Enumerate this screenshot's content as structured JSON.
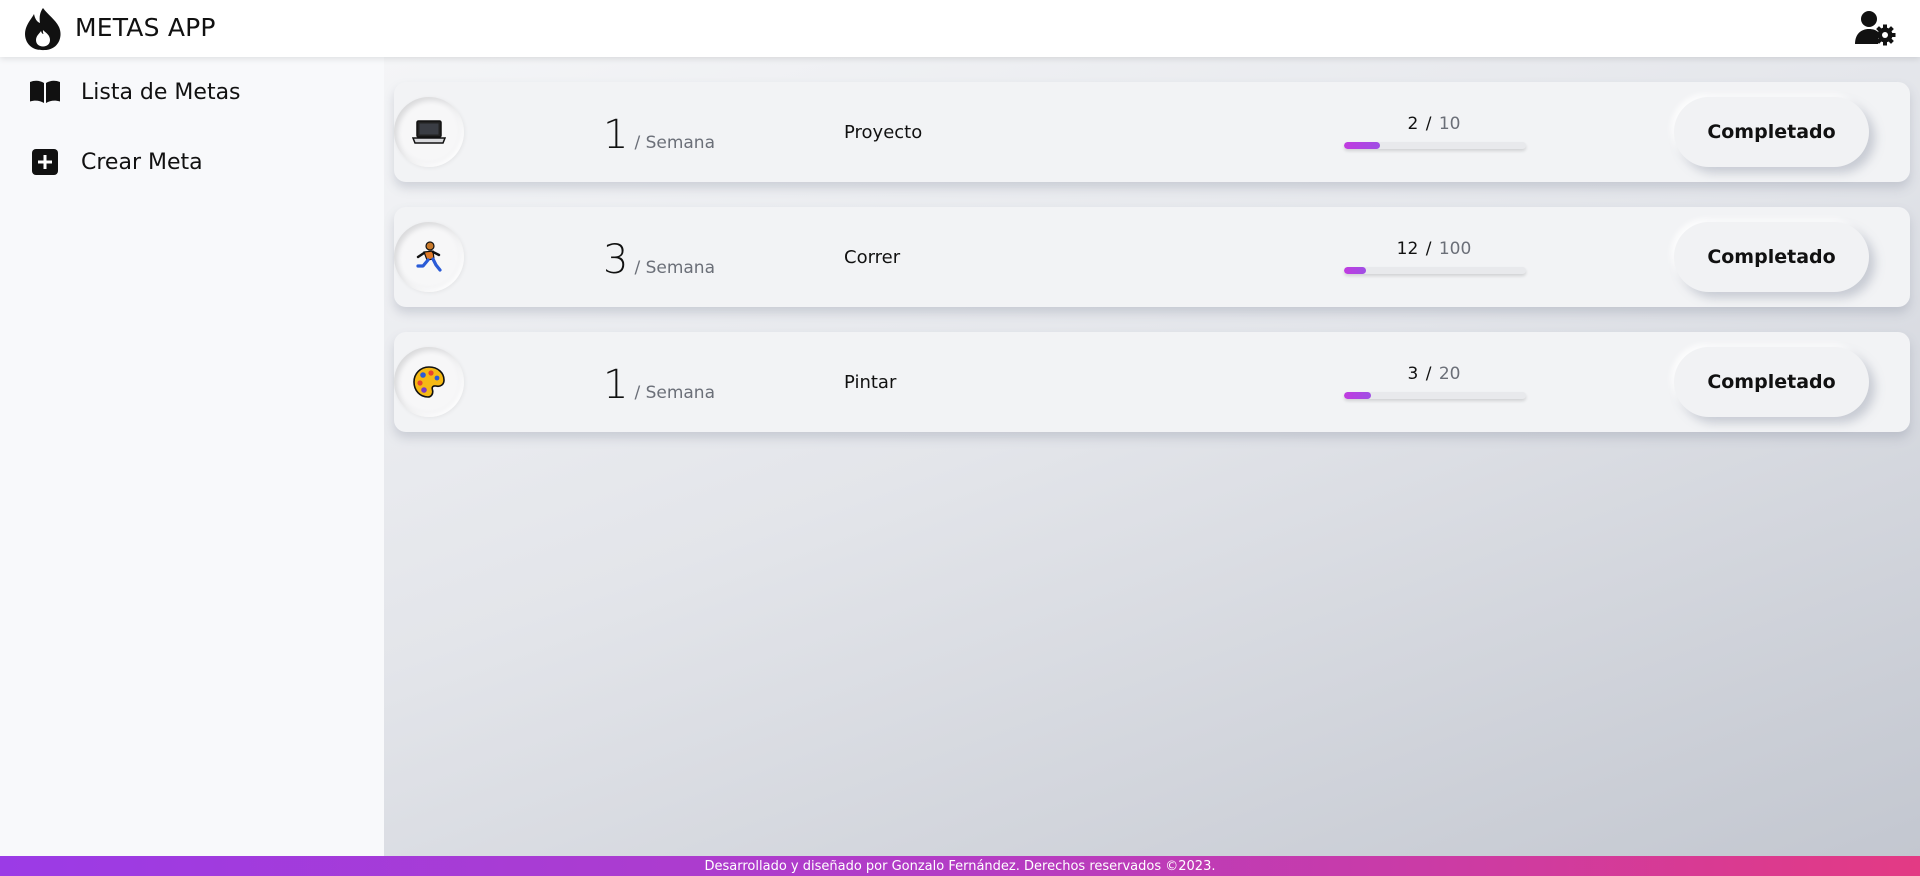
{
  "header": {
    "title": "METAS APP",
    "logo_icon": "flame-icon",
    "user_icon": "user-settings-icon"
  },
  "sidebar": {
    "items": [
      {
        "label": "Lista de Metas",
        "icon": "book-open-icon"
      },
      {
        "label": "Crear Meta",
        "icon": "plus-square-icon"
      }
    ]
  },
  "goals": [
    {
      "icon": "laptop-icon",
      "frequency": "1",
      "period": "/ Semana",
      "name": "Proyecto",
      "completed": "2",
      "slash": "/",
      "target": "10",
      "progress": 0.2,
      "button": "Completado"
    },
    {
      "icon": "runner-icon",
      "frequency": "3",
      "period": "/ Semana",
      "name": "Correr",
      "completed": "12",
      "slash": "/",
      "target": "100",
      "progress": 0.12,
      "button": "Completado"
    },
    {
      "icon": "palette-icon",
      "frequency": "1",
      "period": "/ Semana",
      "name": "Pintar",
      "completed": "3",
      "slash": "/",
      "target": "20",
      "progress": 0.15,
      "button": "Completado"
    }
  ],
  "footer": {
    "text": "Desarrollado y diseñado por Gonzalo Fernández. Derechos reservados ©2023."
  },
  "colors": {
    "progress_start": "#c13be0",
    "progress_end": "#9f4fe4",
    "footer_start": "#9b3be6",
    "footer_end": "#e33a84"
  }
}
